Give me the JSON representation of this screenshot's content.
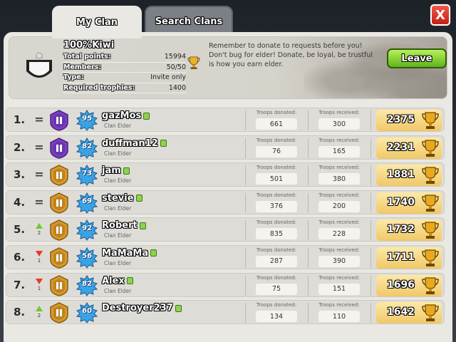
{
  "tabs": {
    "my_clan": "My Clan",
    "search_clans": "Search Clans"
  },
  "close_label": "X",
  "clan": {
    "name": "100%Kiwi",
    "stats": [
      {
        "label": "Total points:",
        "value": "15994"
      },
      {
        "label": "Members:",
        "value": "50/50"
      },
      {
        "label": "Type:",
        "value": "Invite only"
      },
      {
        "label": "Required trophies:",
        "value": "1400"
      }
    ],
    "description": "Remember to donate to requests before you! Don't bug for elder! Donate, be loyal, be trustful is how you earn elder.",
    "leave_label": "Leave"
  },
  "labels": {
    "donated": "Troops donated:",
    "received": "Troops received:"
  },
  "colors": {
    "accent_green": "#6fc934",
    "down_red": "#e23a2c",
    "league_purple": "#7a3fc0",
    "league_gold": "#d79a2a",
    "level_blue": "#3aa3e6"
  },
  "members": [
    {
      "rank": "1.",
      "change": "=",
      "change_dir": "none",
      "change_num": "",
      "league": "purple",
      "level": "95",
      "name": "gazMos",
      "role": "Clan Elder",
      "donated": "661",
      "received": "300",
      "trophies": "2375"
    },
    {
      "rank": "2.",
      "change": "=",
      "change_dir": "none",
      "change_num": "",
      "league": "purple",
      "level": "82",
      "name": "duffman12",
      "role": "Clan Elder",
      "donated": "76",
      "received": "165",
      "trophies": "2231"
    },
    {
      "rank": "3.",
      "change": "=",
      "change_dir": "none",
      "change_num": "",
      "league": "gold",
      "level": "73",
      "name": "jam",
      "role": "Clan Elder",
      "donated": "501",
      "received": "380",
      "trophies": "1881"
    },
    {
      "rank": "4.",
      "change": "=",
      "change_dir": "none",
      "change_num": "",
      "league": "gold",
      "level": "69",
      "name": "stevie",
      "role": "Clan Elder",
      "donated": "376",
      "received": "200",
      "trophies": "1740"
    },
    {
      "rank": "5.",
      "change": "",
      "change_dir": "up",
      "change_num": "2",
      "league": "gold",
      "level": "92",
      "name": "Robert",
      "role": "Clan Elder",
      "donated": "835",
      "received": "228",
      "trophies": "1732"
    },
    {
      "rank": "6.",
      "change": "",
      "change_dir": "down",
      "change_num": "1",
      "league": "gold",
      "level": "56",
      "name": "MaMaMa",
      "role": "Clan Elder",
      "donated": "287",
      "received": "390",
      "trophies": "1711"
    },
    {
      "rank": "7.",
      "change": "",
      "change_dir": "down",
      "change_num": "1",
      "league": "gold",
      "level": "82",
      "name": "Alex",
      "role": "Clan Elder",
      "donated": "75",
      "received": "151",
      "trophies": "1696"
    },
    {
      "rank": "8.",
      "change": "",
      "change_dir": "up",
      "change_num": "2",
      "league": "gold",
      "level": "60",
      "name": "Destroyer237",
      "role": "",
      "donated": "134",
      "received": "110",
      "trophies": "1642"
    }
  ]
}
